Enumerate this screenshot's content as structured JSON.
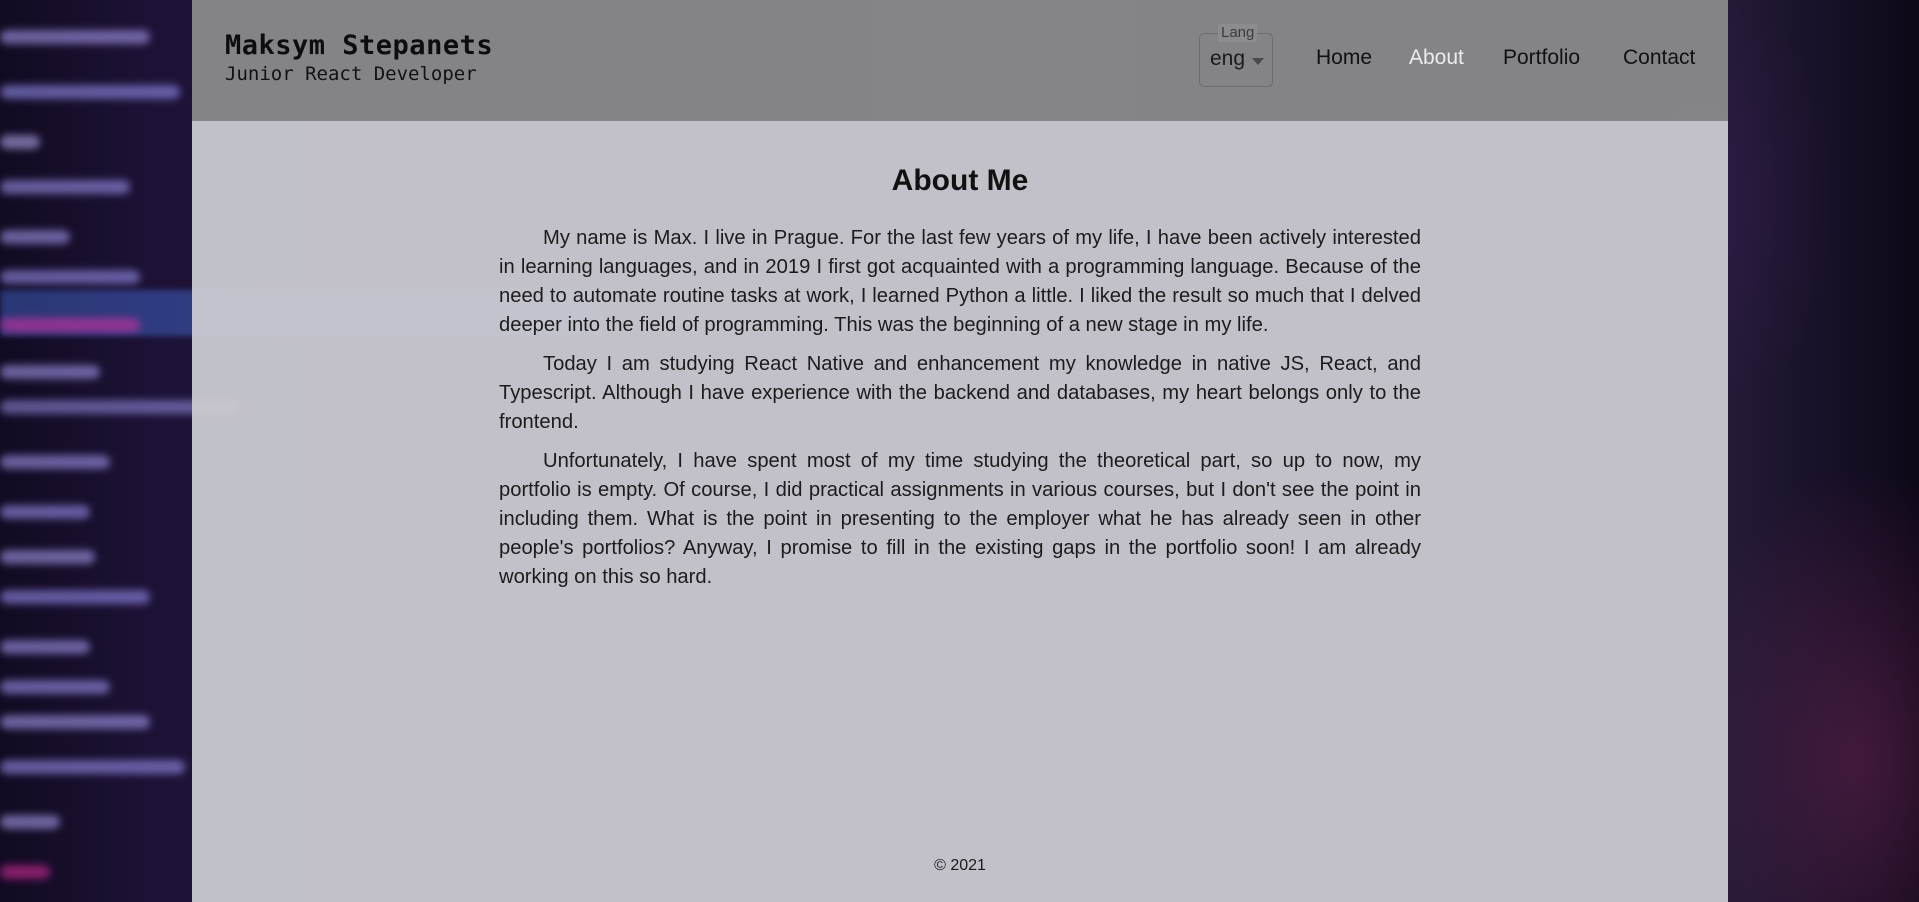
{
  "header": {
    "name": "Maksym Stepanets",
    "subtitle": "Junior React Developer",
    "lang": {
      "legend": "Lang",
      "value": "eng"
    },
    "nav": {
      "home": "Home",
      "about": "About",
      "portfolio": "Portfolio",
      "contact": "Contact",
      "active": "about"
    }
  },
  "main": {
    "title": "About Me",
    "paragraphs": [
      "My name is Max. I live in Prague. For the last few years of my life, I have been actively interested in learning languages, and in 2019 I first got acquainted with a programming language. Because of the need to automate routine tasks at work, I learned Python a little. I liked the result so much that I delved deeper into the field of programming. This was the beginning of a new stage in my life.",
      "Today I am studying React Native and enhancement my knowledge in native JS, React, and Typescript. Although I have experience with the backend and databases, my heart belongs only to the frontend.",
      "Unfortunately, I have spent most of my time studying the theoretical part, so up to now, my portfolio is empty. Of course, I did practical assignments in various courses, but I don't see the point in including them. What is the point in presenting to the employer what he has already seen in other people's portfolios? Anyway, I promise to fill in the existing gaps in the portfolio soon! I am already working on this so hard."
    ]
  },
  "footer": {
    "copyright": "© 2021"
  }
}
